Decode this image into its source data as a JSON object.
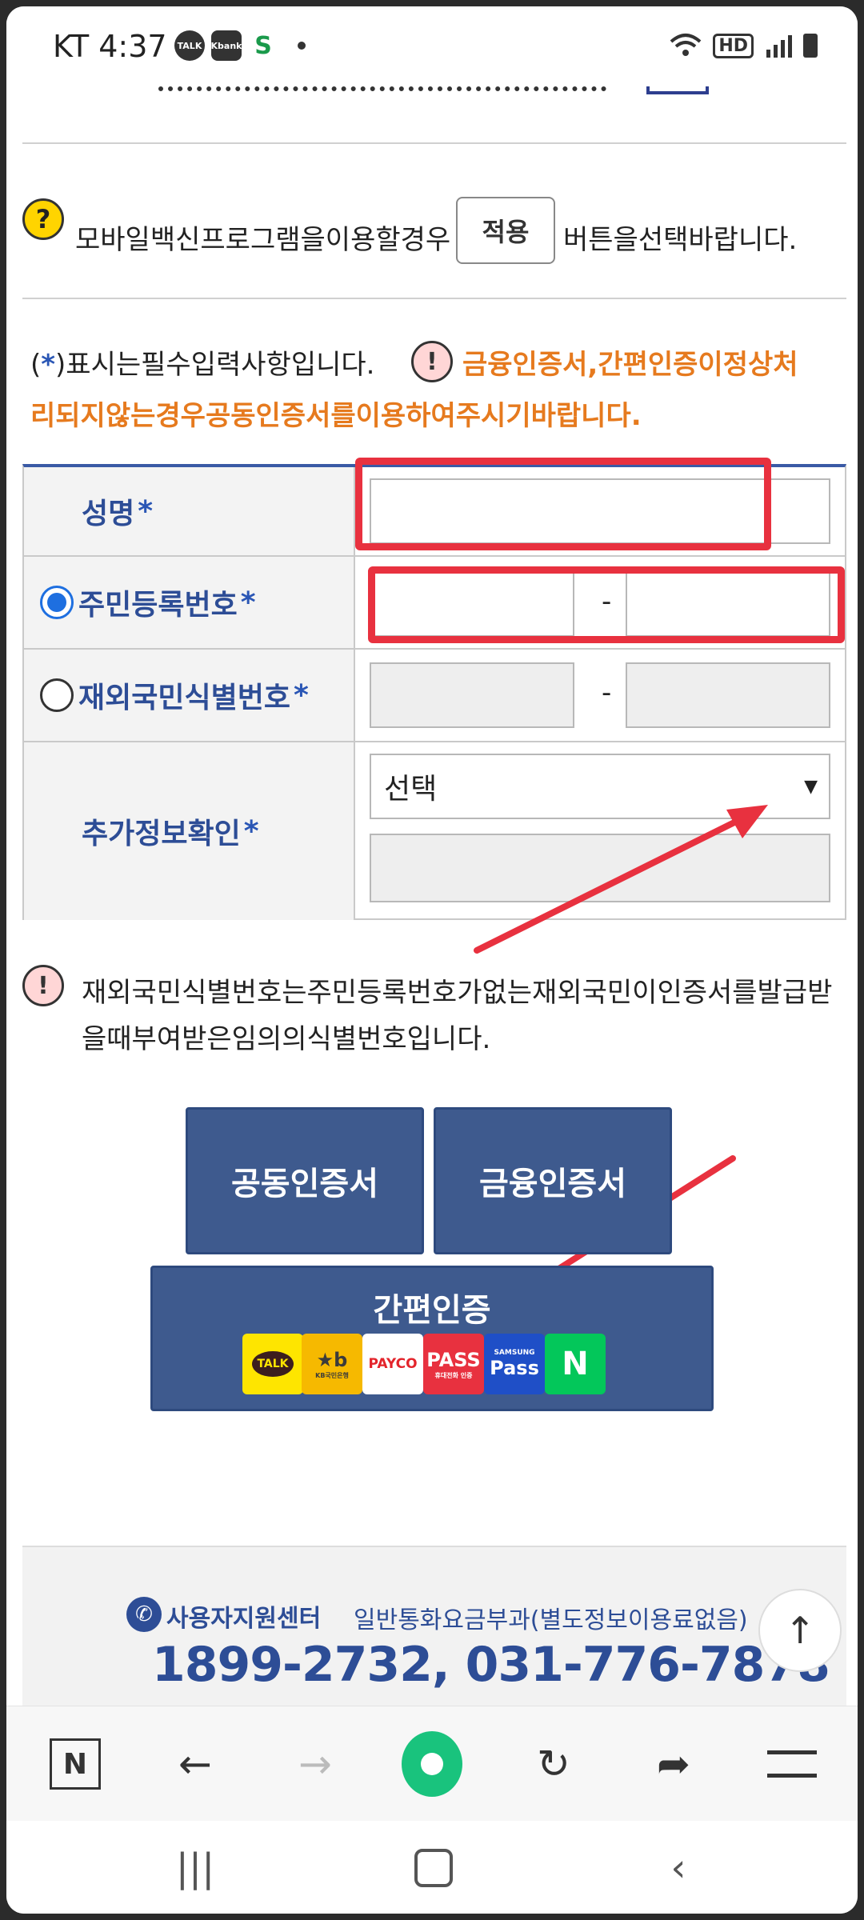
{
  "status": {
    "time": "KT 4:37",
    "icons": [
      "talk-icon",
      "kbank-icon",
      "shinhan-icon",
      "dot-icon"
    ],
    "talk_badge": "TALK",
    "kbank_badge": "Kbank",
    "hd": "HD"
  },
  "vaccine": {
    "text_before": "모바일백신프로그램을이용할경우",
    "apply_button": "적용",
    "text_after": "버튼을선택바랍니다."
  },
  "notes": {
    "required_open": "(",
    "required_star": "*",
    "required_text": ")표시는필수입력사항입니다.",
    "warning_line1": "금융인증서,간편인증이정상처",
    "warning_line2": "리되지않는경우공동인증서를이용하여주시기바랍니다."
  },
  "form": {
    "name_label": "성명",
    "resident_label": "주민등록번호",
    "overseas_label": "재외국민식별번호",
    "extra_label": "추가정보확인",
    "star": "*",
    "dash": "-",
    "select_value": "선택",
    "select_arrow": "▼"
  },
  "overseas_note": "재외국민식별번호는주민등록번호가없는재외국민이인증서를발급받을때부여받은임의의식별번호입니다.",
  "buttons": {
    "joint_cert": "공동인증서",
    "financial_cert": "금융인증서",
    "simple_auth": "간편인증"
  },
  "providers": [
    {
      "name": "kakao-talk",
      "label": "TALK",
      "sub": "",
      "bg": "#fee500",
      "fg": "#3c1e1e"
    },
    {
      "name": "kb-bank",
      "label": "★b",
      "sub": "KB국민은행",
      "bg": "#f6b900",
      "fg": "#3b3b3b"
    },
    {
      "name": "payco",
      "label": "PAYCO",
      "sub": "",
      "bg": "#ffffff",
      "fg": "#e3242b"
    },
    {
      "name": "pass",
      "label": "PASS",
      "sub": "휴대전화 인증",
      "bg": "#e8313f",
      "fg": "#ffffff"
    },
    {
      "name": "samsung-pass",
      "label": "Pass",
      "sub": "SAMSUNG",
      "bg": "#1f4fc7",
      "fg": "#ffffff"
    },
    {
      "name": "naver",
      "label": "N",
      "sub": "",
      "bg": "#03c75a",
      "fg": "#ffffff"
    }
  ],
  "footer": {
    "support_label": "사용자지원센터",
    "support_note": "일반통화요금부과(별도정보이용료없음)",
    "phone": "1899-2732, 031-776-7878"
  },
  "browser": {
    "items": [
      "naver-home-icon",
      "back-icon",
      "forward-icon",
      "green-dot-icon",
      "refresh-icon",
      "share-icon",
      "menu-icon"
    ]
  },
  "colors": {
    "accent": "#3e5a8e",
    "label_blue": "#2d4d96",
    "warning_orange": "#e67a1e",
    "annotation_red": "#e8313f"
  }
}
